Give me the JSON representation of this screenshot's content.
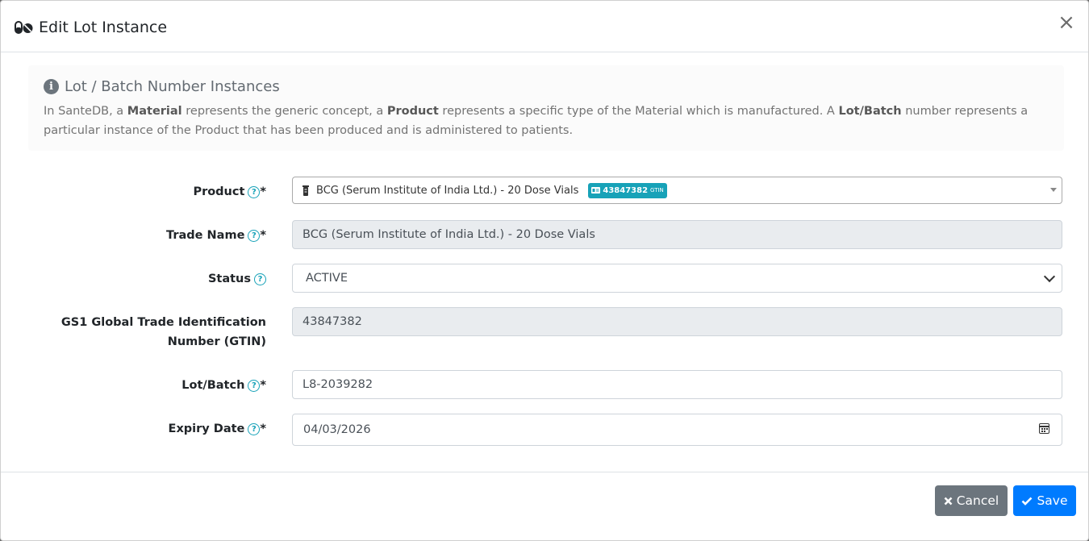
{
  "header": {
    "title": "Edit Lot Instance",
    "close_label": "×"
  },
  "callout": {
    "title": "Lot / Batch Number Instances",
    "text_1": "In SanteDB, a ",
    "bold_material": "Material",
    "text_2": " represents the generic concept, a ",
    "bold_product": "Product",
    "text_3": " represents a specific type of the Material which is manufactured. A ",
    "bold_lot": "Lot/Batch",
    "text_4": " number represents a particular instance of the Product that has been produced and is administered to patients."
  },
  "form": {
    "product": {
      "label": "Product",
      "required": "*",
      "value": "BCG (Serum Institute of India Ltd.) - 20 Dose Vials",
      "badge_value": "43847382",
      "badge_suffix": "GTIN"
    },
    "trade_name": {
      "label": "Trade Name",
      "required": "*",
      "value": "BCG (Serum Institute of India Ltd.) - 20 Dose Vials"
    },
    "status": {
      "label": "Status",
      "value": "ACTIVE"
    },
    "gtin": {
      "label_line1": "GS1 Global Trade Identification",
      "label_line2": "Number (GTIN)",
      "value": "43847382"
    },
    "lot_batch": {
      "label": "Lot/Batch",
      "required": "*",
      "value": "L8-2039282"
    },
    "expiry": {
      "label": "Expiry Date",
      "required": "*",
      "value": "04/03/2026"
    }
  },
  "footer": {
    "cancel_label": "Cancel",
    "save_label": "Save"
  },
  "help_glyph": "?",
  "colors": {
    "primary": "#007bff",
    "secondary": "#6c757d",
    "info": "#17a2b8"
  }
}
